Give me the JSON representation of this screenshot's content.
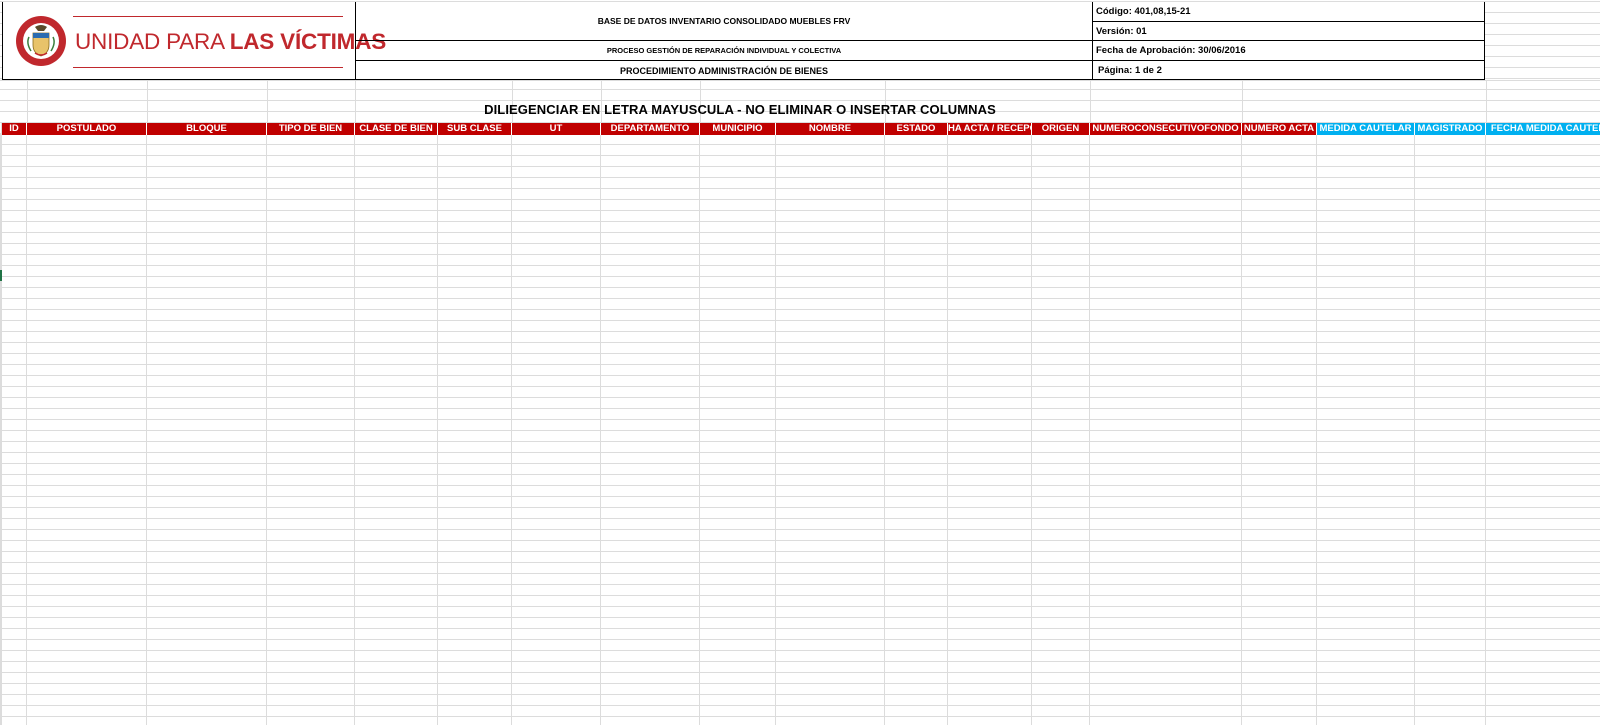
{
  "header": {
    "logo": {
      "text_regular": "UNIDAD PARA ",
      "text_bold": "LAS VÍCTIMAS",
      "seal_label": "REPÚBLICA DE COLOMBIA"
    },
    "doc_title": "BASE DE DATOS INVENTARIO CONSOLIDADO MUEBLES FRV",
    "process": "PROCESO GESTIÓN DE REPARACIÓN INDIVIDUAL Y COLECTIVA",
    "procedure": "PROCEDIMIENTO ADMINISTRACIÓN DE BIENES",
    "code": "Código: 401,08,15-21",
    "version": "Versión: 01",
    "approval_date": "Fecha de Aprobación: 30/06/2016",
    "page": "Página: 1 de 2"
  },
  "instruction": "DILIEGENCIAR EN LETRA MAYUSCULA - NO ELIMINAR O INSERTAR COLUMNAS",
  "columns": [
    {
      "label": "ID",
      "color": "#c00000"
    },
    {
      "label": "POSTULADO",
      "color": "#c00000"
    },
    {
      "label": "BLOQUE",
      "color": "#c00000"
    },
    {
      "label": "TIPO DE BIEN",
      "color": "#c00000"
    },
    {
      "label": "CLASE DE BIEN",
      "color": "#c00000"
    },
    {
      "label": "SUB CLASE",
      "color": "#c00000"
    },
    {
      "label": "UT",
      "color": "#c00000"
    },
    {
      "label": "DEPARTAMENTO",
      "color": "#c00000"
    },
    {
      "label": "MUNICIPIO",
      "color": "#c00000"
    },
    {
      "label": "NOMBRE",
      "color": "#c00000"
    },
    {
      "label": "ESTADO",
      "color": "#c00000"
    },
    {
      "label": "HA ACTA / RECEPC",
      "color": "#c00000"
    },
    {
      "label": "ORIGEN",
      "color": "#c00000"
    },
    {
      "label": "NUMEROCONSECUTIVOFONDO",
      "color": "#c00000"
    },
    {
      "label": "NUMERO ACTA",
      "color": "#c00000"
    },
    {
      "label": "MEDIDA CAUTELAR",
      "color": "#00b0f0"
    },
    {
      "label": "MAGISTRADO",
      "color": "#00b0f0"
    },
    {
      "label": "FECHA MEDIDA CAUTEL",
      "color": "#00b0f0"
    }
  ],
  "colors": {
    "header_red": "#c00000",
    "header_blue": "#00b0f0",
    "brand_red": "#c0282d",
    "gridline": "#dcdcdc",
    "active_cell": "#217346"
  }
}
